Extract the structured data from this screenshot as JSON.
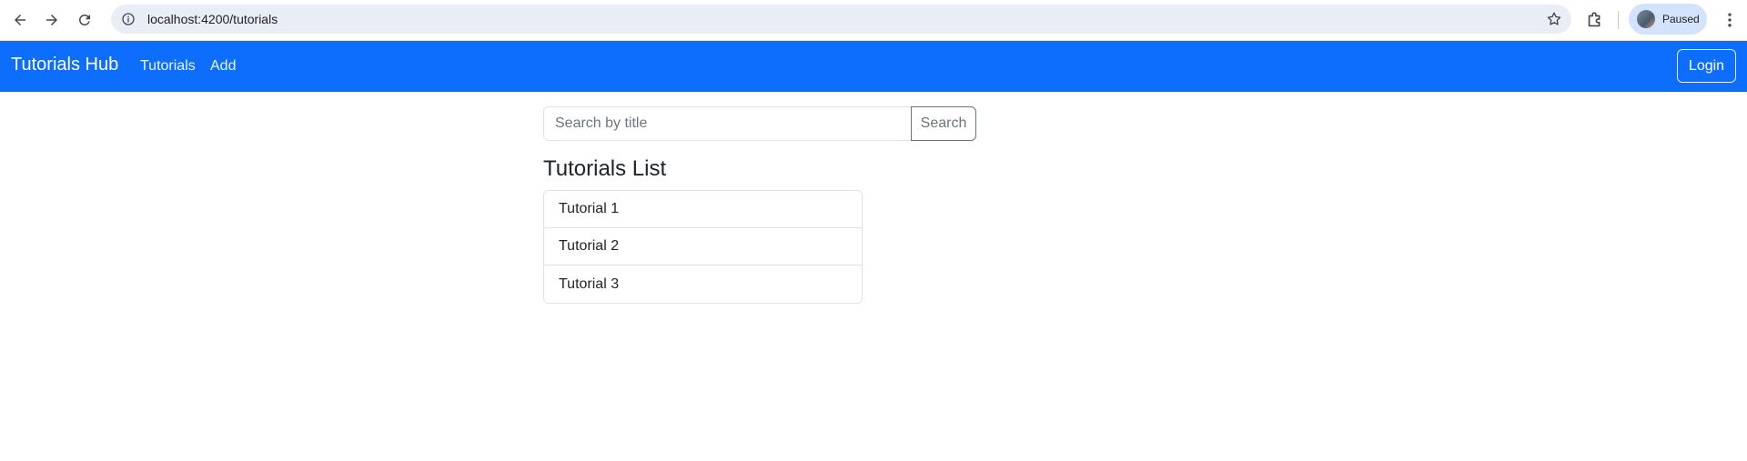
{
  "browser": {
    "url": "localhost:4200/tutorials",
    "profile_status": "Paused"
  },
  "navbar": {
    "brand": "Tutorials Hub",
    "links": [
      "Tutorials",
      "Add"
    ],
    "login_label": "Login",
    "color": "#0d6efd"
  },
  "search": {
    "placeholder": "Search by title",
    "value": "",
    "button_label": "Search"
  },
  "tutorials": {
    "title": "Tutorials List",
    "items": [
      "Tutorial 1",
      "Tutorial 2",
      "Tutorial 3"
    ]
  }
}
